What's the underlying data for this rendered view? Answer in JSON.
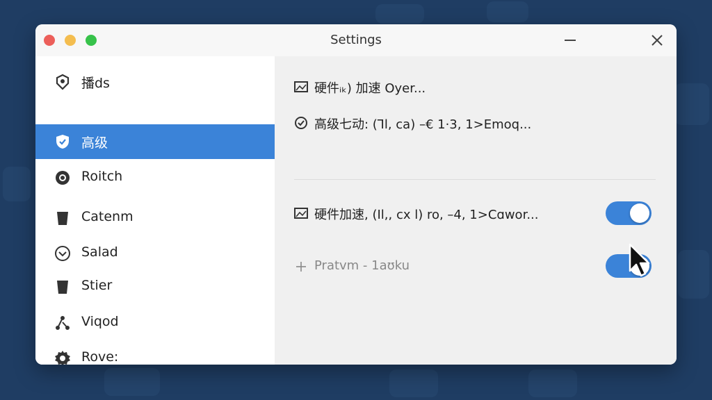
{
  "window": {
    "title": "Settings",
    "minimize_icon": "minimize-icon",
    "close_icon": "close-icon"
  },
  "sidebar": {
    "items": [
      {
        "label": "播ds",
        "icon": "badge-icon",
        "active": false
      },
      {
        "label": "高级",
        "icon": "shield-icon",
        "active": true
      },
      {
        "label": "Roitch",
        "icon": "circle-icon",
        "active": false
      },
      {
        "label": "Catenm",
        "icon": "bin-icon",
        "active": false
      },
      {
        "label": "Salad",
        "icon": "chevron-circle-icon",
        "active": false
      },
      {
        "label": "Stier",
        "icon": "bin-icon",
        "active": false
      },
      {
        "label": "Viqod",
        "icon": "share-icon",
        "active": false
      },
      {
        "label": "Rove:",
        "icon": "gear-icon",
        "active": false
      }
    ]
  },
  "content": {
    "rows": [
      {
        "label": "硬件ᵢₖ) 加速 Oyer...",
        "icon": "image-icon"
      },
      {
        "label": "高级七动: (Ꞁl, ca) –€ 1·3, 1>Emoq...",
        "icon": "circle-check-icon"
      },
      {
        "label": "硬件加速, (Ⅰl,, cx l) ro, –4, 1>Cɑwor...",
        "icon": "image-icon",
        "toggle": true
      },
      {
        "label": "Pratvm - 1aʊku",
        "icon": "plus-icon",
        "toggle": true,
        "muted": true
      }
    ]
  },
  "colors": {
    "accent": "#3b83d8",
    "background": "#1f3d63"
  }
}
